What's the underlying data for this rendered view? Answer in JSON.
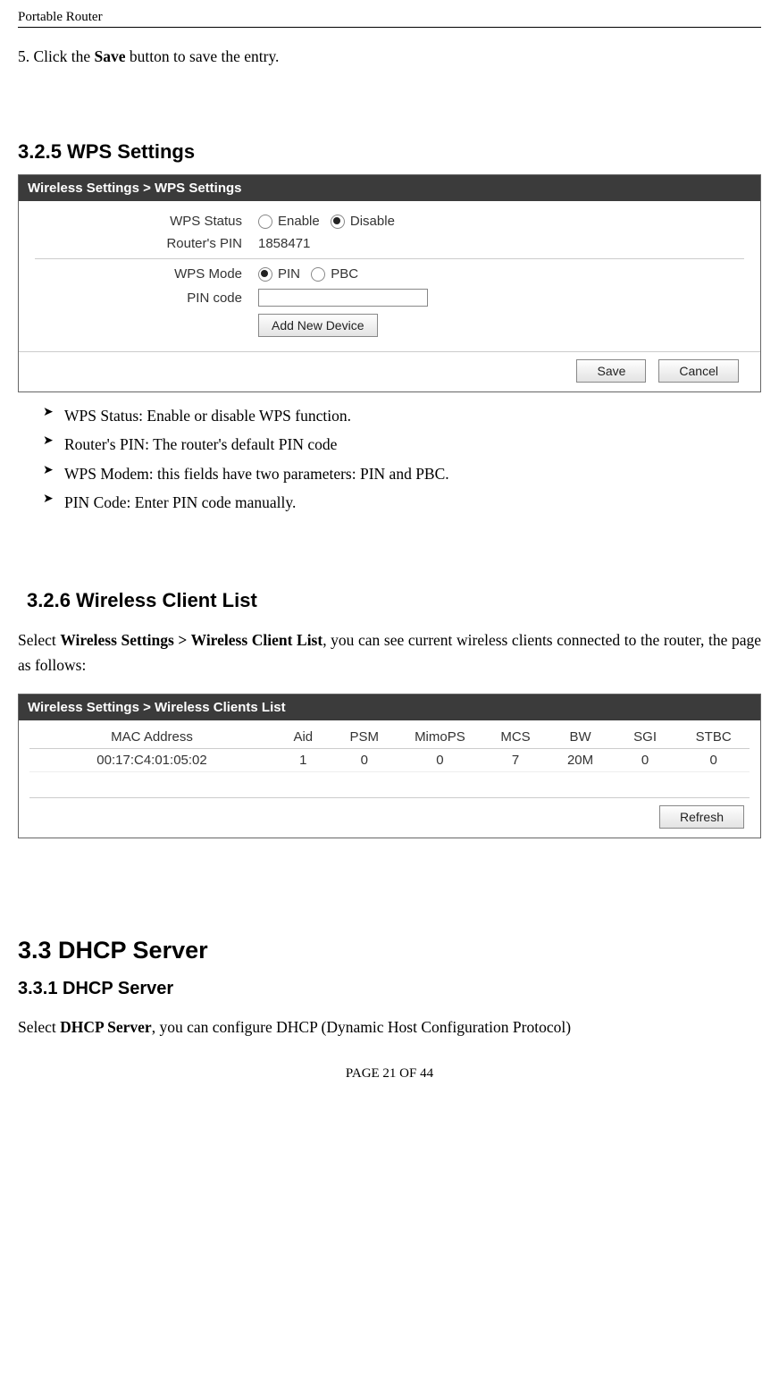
{
  "header": {
    "title": "Portable Router"
  },
  "intro": {
    "prefix": "5. Click the ",
    "bold": "Save",
    "suffix": " button to save the entry."
  },
  "sec325": {
    "heading": "3.2.5 WPS Settings",
    "panel_title": "Wireless Settings > WPS Settings",
    "wps_status_label": "WPS Status",
    "enable": "Enable",
    "disable": "Disable",
    "router_pin_label": "Router's PIN",
    "router_pin_value": "1858471",
    "wps_mode_label": "WPS Mode",
    "pin": "PIN",
    "pbc": "PBC",
    "pin_code_label": "PIN code",
    "add_new": "Add New Device",
    "save": "Save",
    "cancel": "Cancel",
    "bullets": [
      "WPS Status: Enable or disable WPS function.",
      "Router's PIN: The router's default PIN code",
      "WPS Modem: this fields have two parameters: PIN and PBC.",
      "PIN Code: Enter PIN code manually."
    ]
  },
  "sec326": {
    "heading": "3.2.6 Wireless Client List",
    "para_prefix": "Select ",
    "para_bold": "Wireless Settings > Wireless Client List",
    "para_suffix": ", you can see current wireless clients connected to the router, the page as follows:",
    "panel_title": "Wireless Settings > Wireless Clients List",
    "cols": [
      "MAC Address",
      "Aid",
      "PSM",
      "MimoPS",
      "MCS",
      "BW",
      "SGI",
      "STBC"
    ],
    "row": [
      "00:17:C4:01:05:02",
      "1",
      "0",
      "0",
      "7",
      "20M",
      "0",
      "0"
    ],
    "refresh": "Refresh"
  },
  "sec33": {
    "heading": "3.3 DHCP Server",
    "sub": "3.3.1 DHCP Server",
    "para_prefix": "Select ",
    "para_bold": "DHCP Server",
    "para_suffix": ", you can configure DHCP (Dynamic Host Configuration Protocol)"
  },
  "footer": {
    "page": "PAGE    21    OF    44"
  }
}
